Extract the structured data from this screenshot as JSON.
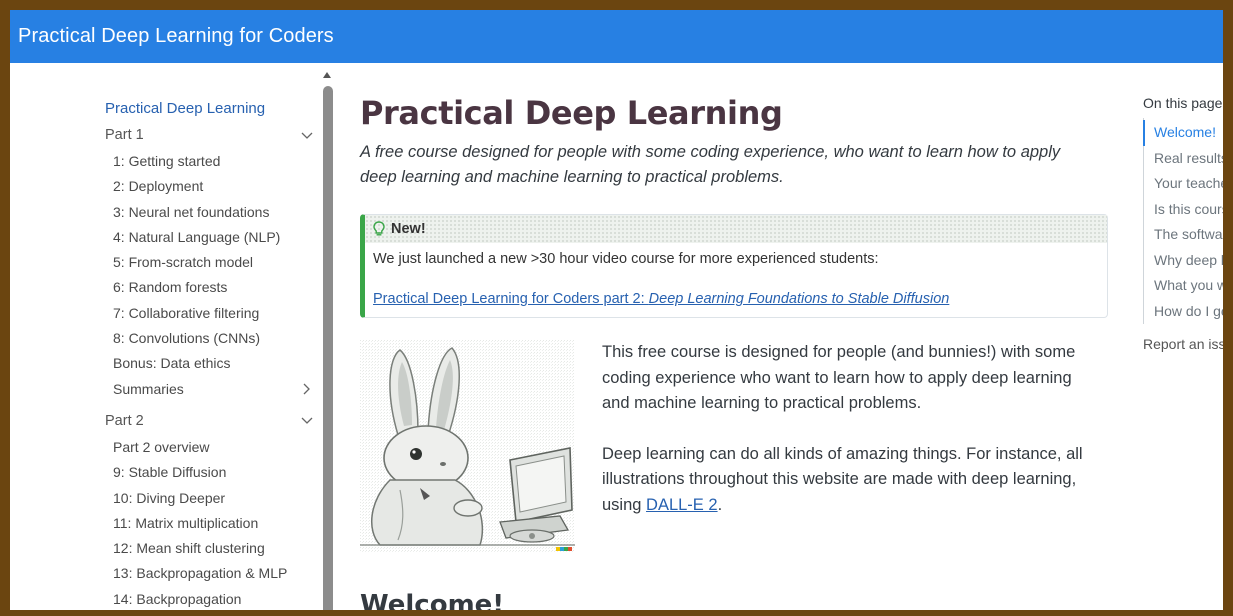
{
  "header": {
    "site_title": "Practical Deep Learning for Coders"
  },
  "sidebar": {
    "title": "Practical Deep Learning",
    "part1": {
      "label": "Part 1",
      "items": [
        "1: Getting started",
        "2: Deployment",
        "3: Neural net foundations",
        "4: Natural Language (NLP)",
        "5: From-scratch model",
        "6: Random forests",
        "7: Collaborative filtering",
        "8: Convolutions (CNNs)",
        "Bonus: Data ethics"
      ],
      "summaries": "Summaries"
    },
    "part2": {
      "label": "Part 2",
      "items": [
        "Part 2 overview",
        "9: Stable Diffusion",
        "10: Diving Deeper",
        "11: Matrix multiplication",
        "12: Mean shift clustering",
        "13: Backpropagation & MLP",
        "14: Backpropagation"
      ]
    }
  },
  "main": {
    "title": "Practical Deep Learning",
    "subtitle": "A free course designed for people with some coding experience, who want to learn how to apply deep learning and machine learning to practical problems.",
    "callout": {
      "heading": "New!",
      "text": "We just launched a new >30 hour video course for more experienced students:",
      "link_prefix": "Practical Deep Learning for Coders part 2: ",
      "link_italic": "Deep Learning Foundations to Stable Diffusion"
    },
    "hero": {
      "p1": "This free course is designed for people (and bunnies!) with some coding experience who want to learn how to apply deep learning and machine learning to practical problems.",
      "p2_prefix": "Deep learning can do all kinds of amazing things. For instance, all illustrations throughout this website are made with deep learning, using ",
      "p2_link": "DALL-E 2",
      "p2_suffix": "."
    },
    "section_heading": "Welcome!"
  },
  "toc": {
    "title": "On this page",
    "items": [
      "Welcome!",
      "Real results",
      "Your teacher",
      "Is this course for me?",
      "The software you will be using",
      "Why deep learning?",
      "What you will learn",
      "How do I get started?"
    ],
    "report_issue": "Report an issue"
  },
  "colors": {
    "accent": "#2780e3",
    "callout_border": "#3aa648",
    "title": "#4a3542"
  }
}
